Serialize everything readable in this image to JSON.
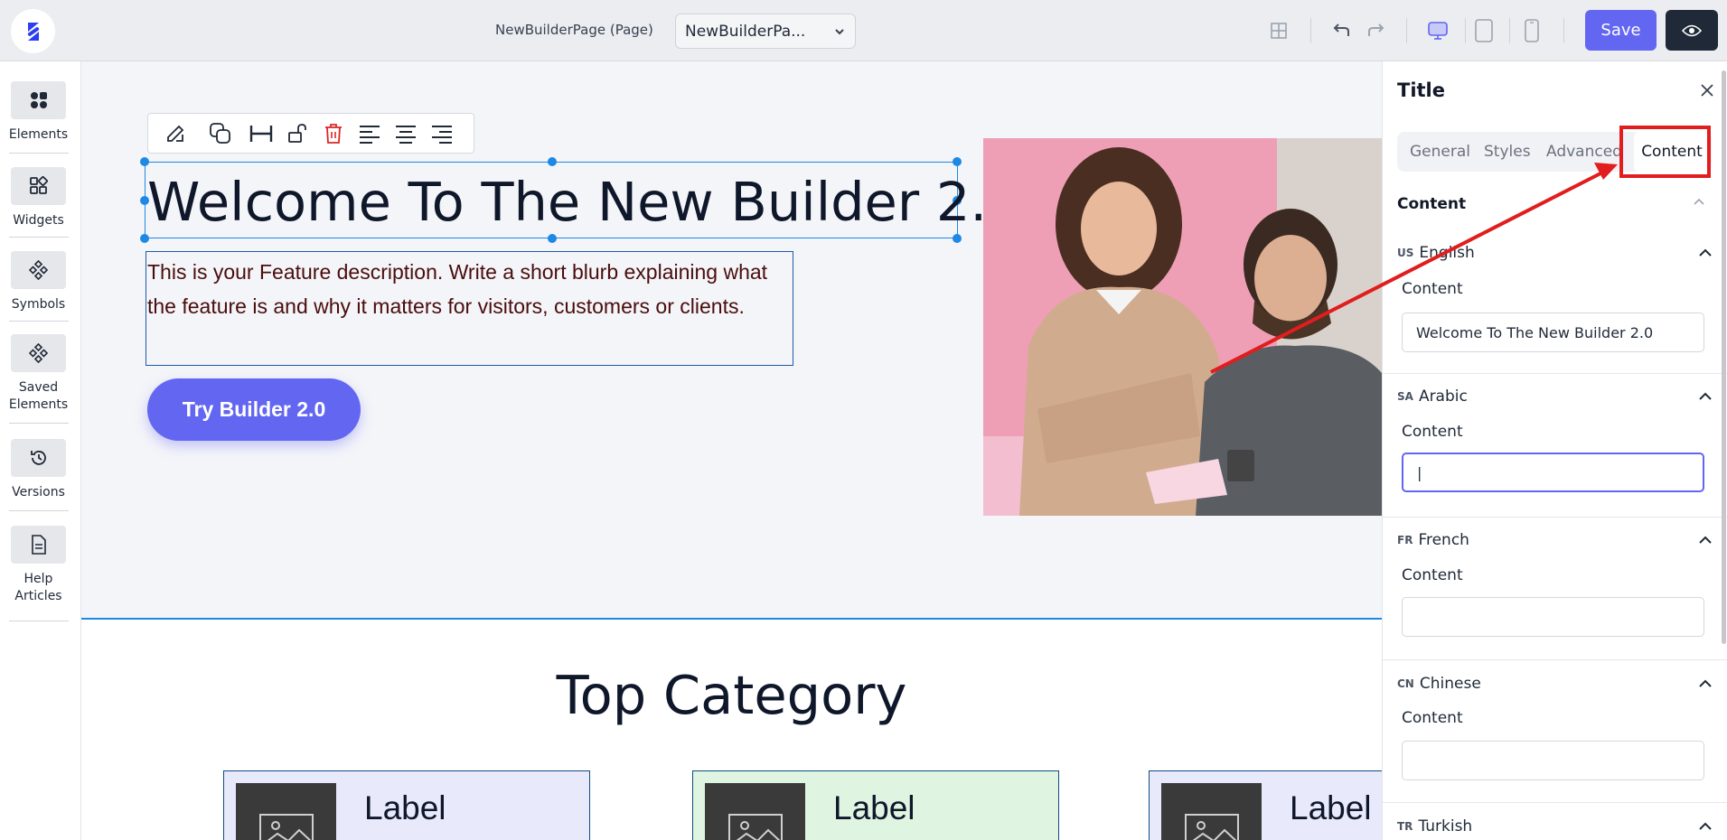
{
  "topbar": {
    "page_name": "NewBuilderPage (Page)",
    "page_select_value": "NewBuilderPa...",
    "save_label": "Save",
    "icons": [
      "grid-icon",
      "undo-icon",
      "redo-icon",
      "desktop-icon",
      "tablet-icon",
      "mobile-icon",
      "eye-icon"
    ],
    "accent_color": "#6366f1"
  },
  "sidebar": {
    "items": [
      {
        "label": "Elements",
        "icon": "elements-icon"
      },
      {
        "label": "Widgets",
        "icon": "widgets-icon"
      },
      {
        "label": "Symbols",
        "icon": "symbols-icon"
      },
      {
        "label": "Saved Elements",
        "icon": "saved-elements-icon"
      },
      {
        "label": "Versions",
        "icon": "history-icon"
      },
      {
        "label": "Help Articles",
        "icon": "document-icon"
      }
    ]
  },
  "canvas": {
    "hero_title": "Welcome To The New Builder 2.0",
    "hero_description": "This is your Feature description. Write a short blurb explaining what the feature is and why it matters for visitors, customers or clients.",
    "cta_label": "Try Builder 2.0",
    "section_title": "Top Category",
    "categories": [
      {
        "label": "Label",
        "bg": "#e8e9fb"
      },
      {
        "label": "Label",
        "bg": "#dff5e1"
      },
      {
        "label": "Label",
        "bg": "#e8e9fb"
      }
    ],
    "edit_toolbar_icons": [
      "edit-icon",
      "duplicate-icon",
      "width-icon",
      "unlock-icon",
      "delete-icon",
      "align-left-icon",
      "align-center-icon",
      "align-right-icon"
    ]
  },
  "panel": {
    "title": "Title",
    "tabs": [
      "General",
      "Styles",
      "Advanced",
      "Content"
    ],
    "active_tab": "Content",
    "section_header": "Content",
    "languages": [
      {
        "code": "US",
        "name": "English",
        "field_label": "Content",
        "value": "Welcome To The New Builder 2.0"
      },
      {
        "code": "SA",
        "name": "Arabic",
        "field_label": "Content",
        "value": "|"
      },
      {
        "code": "FR",
        "name": "French",
        "field_label": "Content",
        "value": ""
      },
      {
        "code": "CN",
        "name": "Chinese",
        "field_label": "Content",
        "value": ""
      },
      {
        "code": "TR",
        "name": "Turkish",
        "field_label": "Content",
        "value": ""
      }
    ]
  },
  "annotation": {
    "color": "#e11d1d"
  }
}
